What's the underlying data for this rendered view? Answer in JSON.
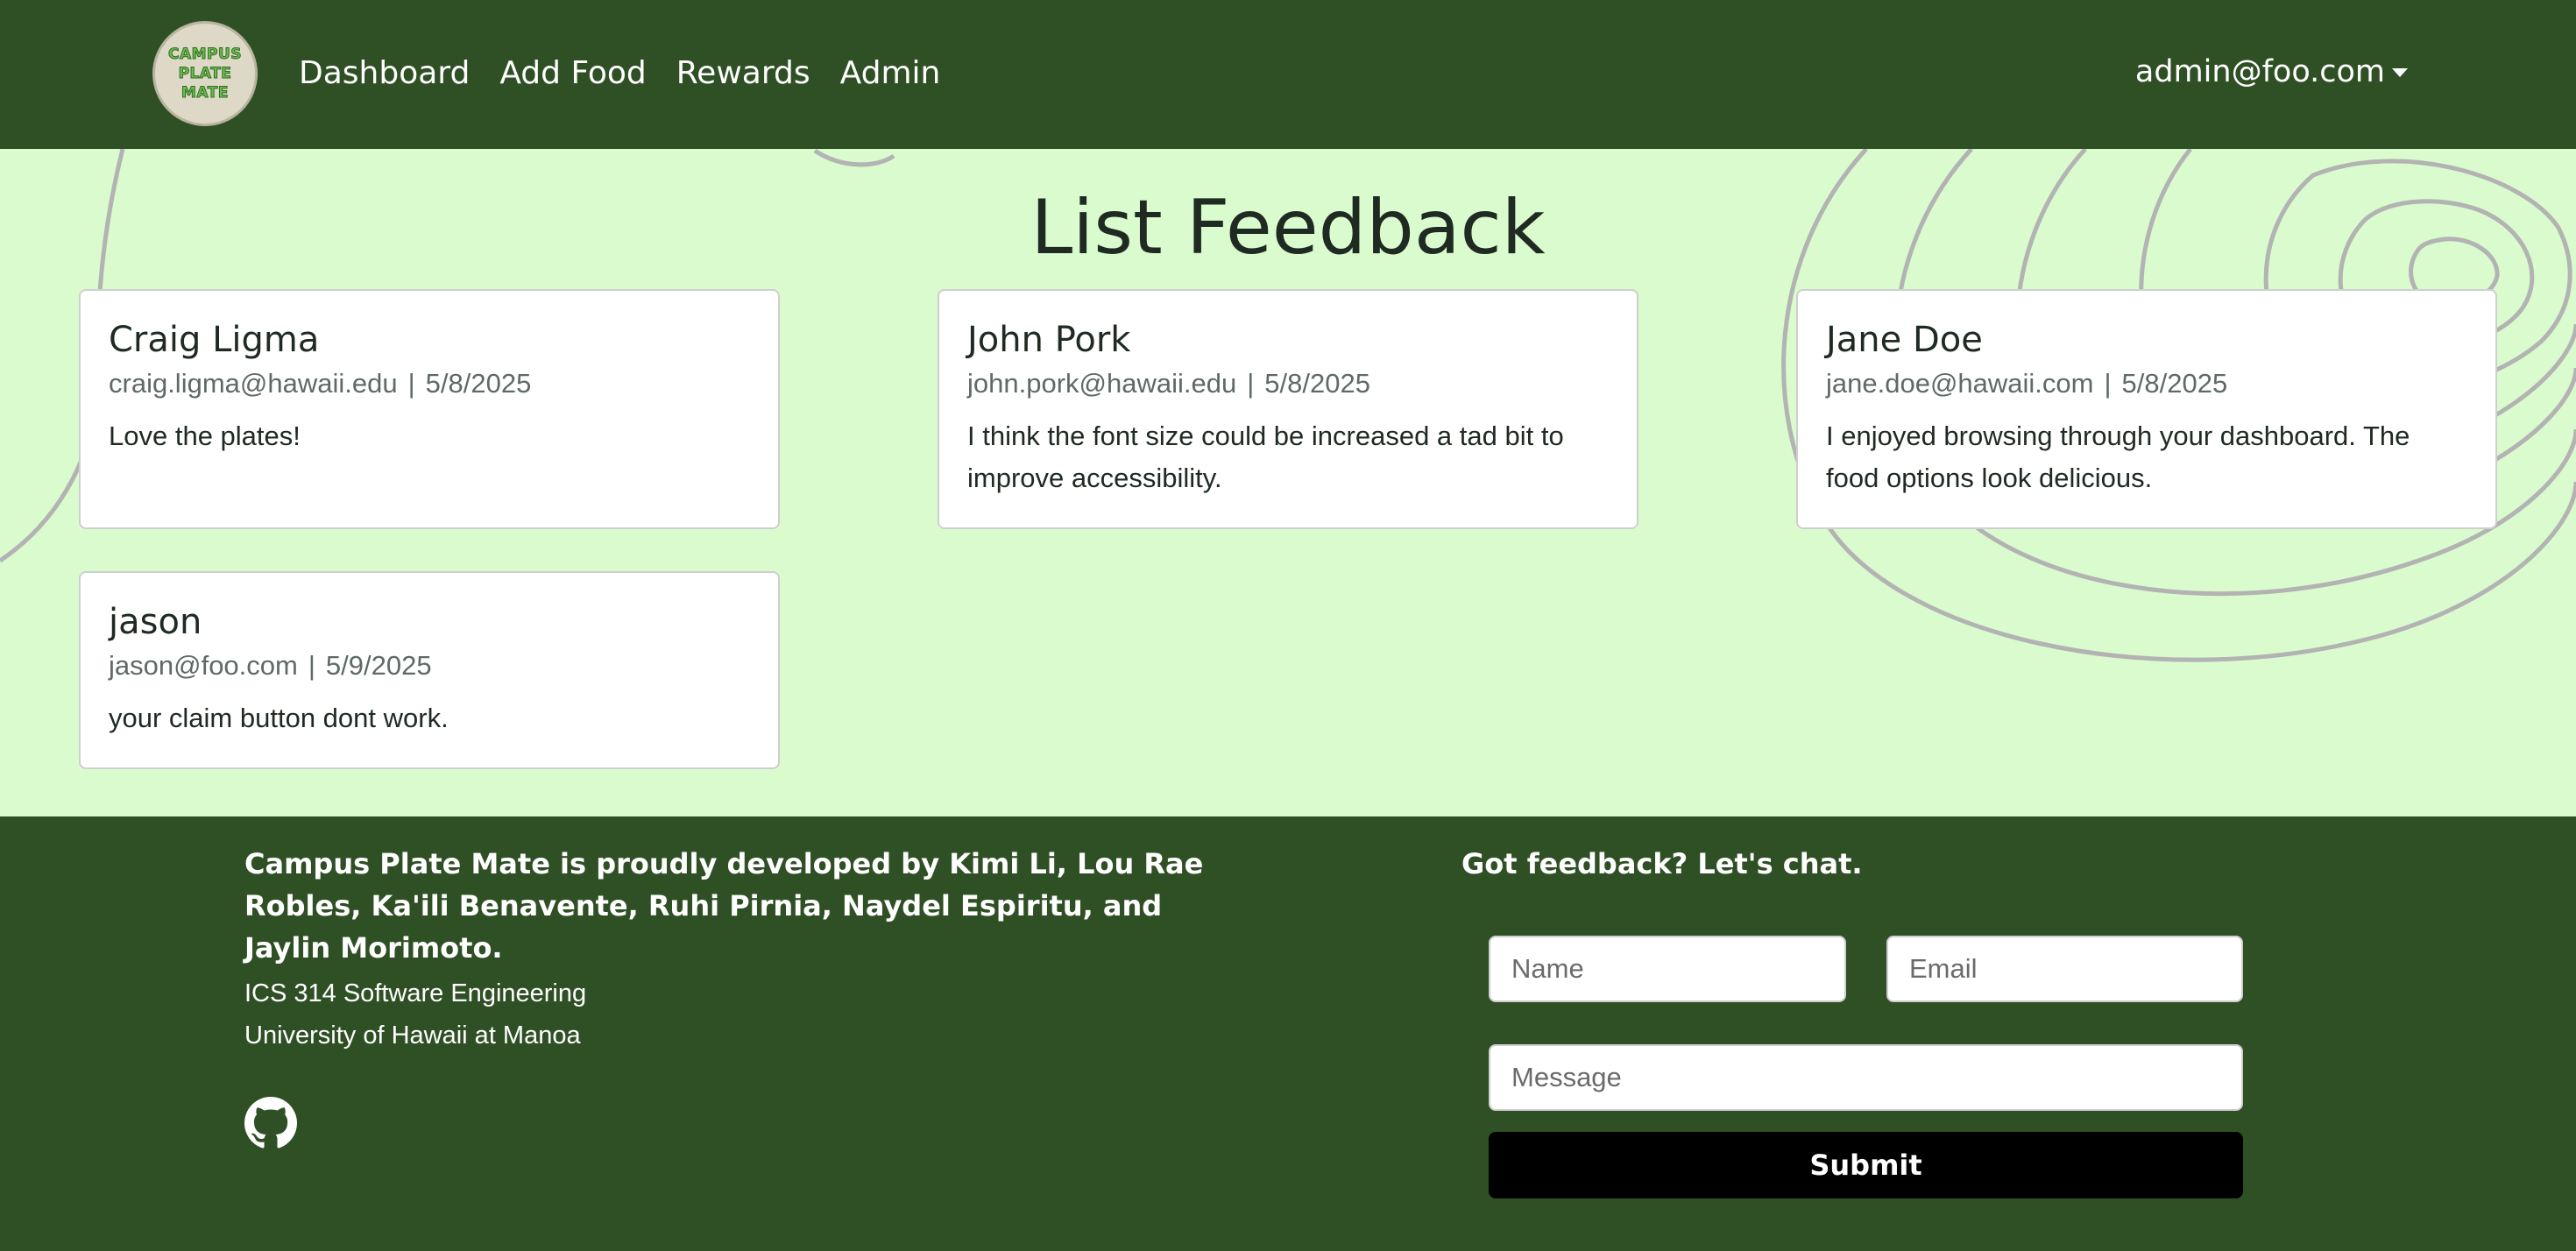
{
  "navbar": {
    "logo_lines": [
      "CAMPUS",
      "PLATE",
      "MATE"
    ],
    "links": [
      "Dashboard",
      "Add Food",
      "Rewards",
      "Admin"
    ],
    "user": "admin@foo.com"
  },
  "page": {
    "title": "List Feedback"
  },
  "feedback": [
    {
      "name": "Craig Ligma",
      "email": "craig.ligma@hawaii.edu",
      "date": "5/8/2025",
      "message": "Love the plates!"
    },
    {
      "name": "John Pork",
      "email": "john.pork@hawaii.edu",
      "date": "5/8/2025",
      "message": "I think the font size could be increased a tad bit to improve accessibility."
    },
    {
      "name": "Jane Doe",
      "email": "jane.doe@hawaii.com",
      "date": "5/8/2025",
      "message": "I enjoyed browsing through your dashboard. The food options look delicious."
    },
    {
      "name": "jason",
      "email": "jason@foo.com",
      "date": "5/9/2025",
      "message": "your claim button dont work."
    }
  ],
  "meta_separator": "|",
  "footer": {
    "credits": "Campus Plate Mate is proudly developed by Kimi Li, Lou Rae Robles, Ka'ili Benavente, Ruhi Pirnia, Naydel Espiritu, and Jaylin Morimoto.",
    "course_line1": "ICS 314 Software Engineering",
    "course_line2": "University of Hawaii at Manoa",
    "github_icon": "github-icon",
    "feedback_title": "Got feedback? Let's chat.",
    "name_placeholder": "Name",
    "email_placeholder": "Email",
    "message_placeholder": "Message",
    "submit_label": "Submit"
  },
  "colors": {
    "nav_bg": "#2f5025",
    "page_bg": "#d9fbce",
    "card_bg": "#ffffff",
    "submit_bg": "#000000"
  }
}
